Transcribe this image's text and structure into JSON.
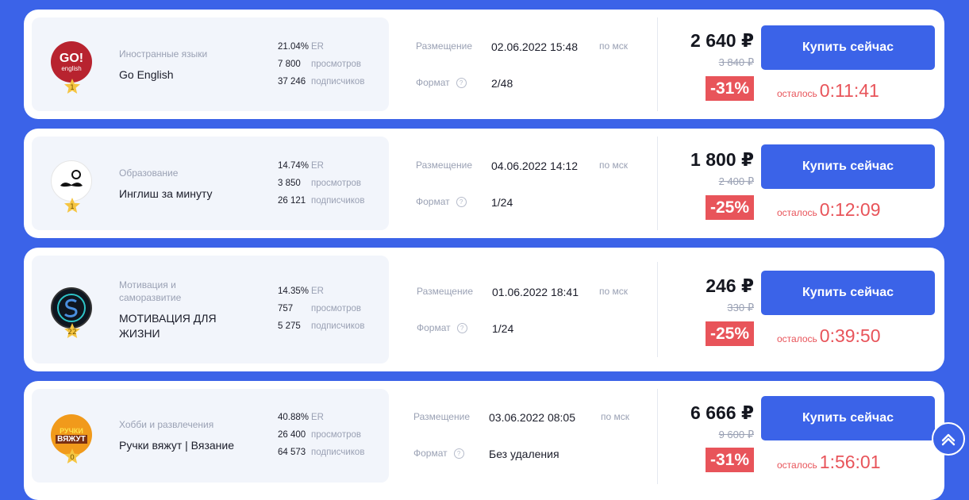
{
  "labels": {
    "placement": "Размещение",
    "format": "Формат",
    "msk": "по мск",
    "buy": "Купить сейчас",
    "remaining": "осталось",
    "er": "ER",
    "views": "просмотров",
    "subscribers": "подписчиков",
    "help_mark": "?"
  },
  "offers": [
    {
      "category": "Иностранные языки",
      "name": "Go English",
      "rank": "1",
      "avatar_text": "GO!",
      "avatar_sub": "english",
      "er": "21.04%",
      "views": "7 800",
      "subscribers": "37 246",
      "placement": "02.06.2022 15:48",
      "format": "2/48",
      "price": "2 640 ₽",
      "old_price": "3 840 ₽",
      "discount": "-31%",
      "timer": "0:11:41"
    },
    {
      "category": "Образование",
      "name": "Инглиш за минуту",
      "rank": "1",
      "er": "14.74%",
      "views": "3 850",
      "subscribers": "26 121",
      "placement": "04.06.2022 14:12",
      "format": "1/24",
      "price": "1 800 ₽",
      "old_price": "2 400 ₽",
      "discount": "-25%",
      "timer": "0:12:09"
    },
    {
      "category": "Мотивация и саморазвитие",
      "name": "МОТИВАЦИЯ ДЛЯ ЖИЗНИ",
      "rank": "22",
      "er": "14.35%",
      "views": "757",
      "subscribers": "5 275",
      "placement": "01.06.2022 18:41",
      "format": "1/24",
      "price": "246 ₽",
      "old_price": "330 ₽",
      "discount": "-25%",
      "timer": "0:39:50"
    },
    {
      "category": "Хобби и развлечения",
      "name": "Ручки вяжут | Вязание",
      "rank": "0",
      "avatar_text": "РУЧКИ",
      "avatar_sub": "ВЯЖУТ",
      "er": "40.88%",
      "views": "26 400",
      "subscribers": "64 573",
      "placement": "03.06.2022 08:05",
      "format": "Без удаления",
      "price": "6 666 ₽",
      "old_price": "9 600 ₽",
      "discount": "-31%",
      "timer": "1:56:01"
    }
  ],
  "colors": {
    "page_bg": "#3b63e8",
    "button": "#3b63e8",
    "accent_red": "#e8545a",
    "star": "#f5c542"
  }
}
